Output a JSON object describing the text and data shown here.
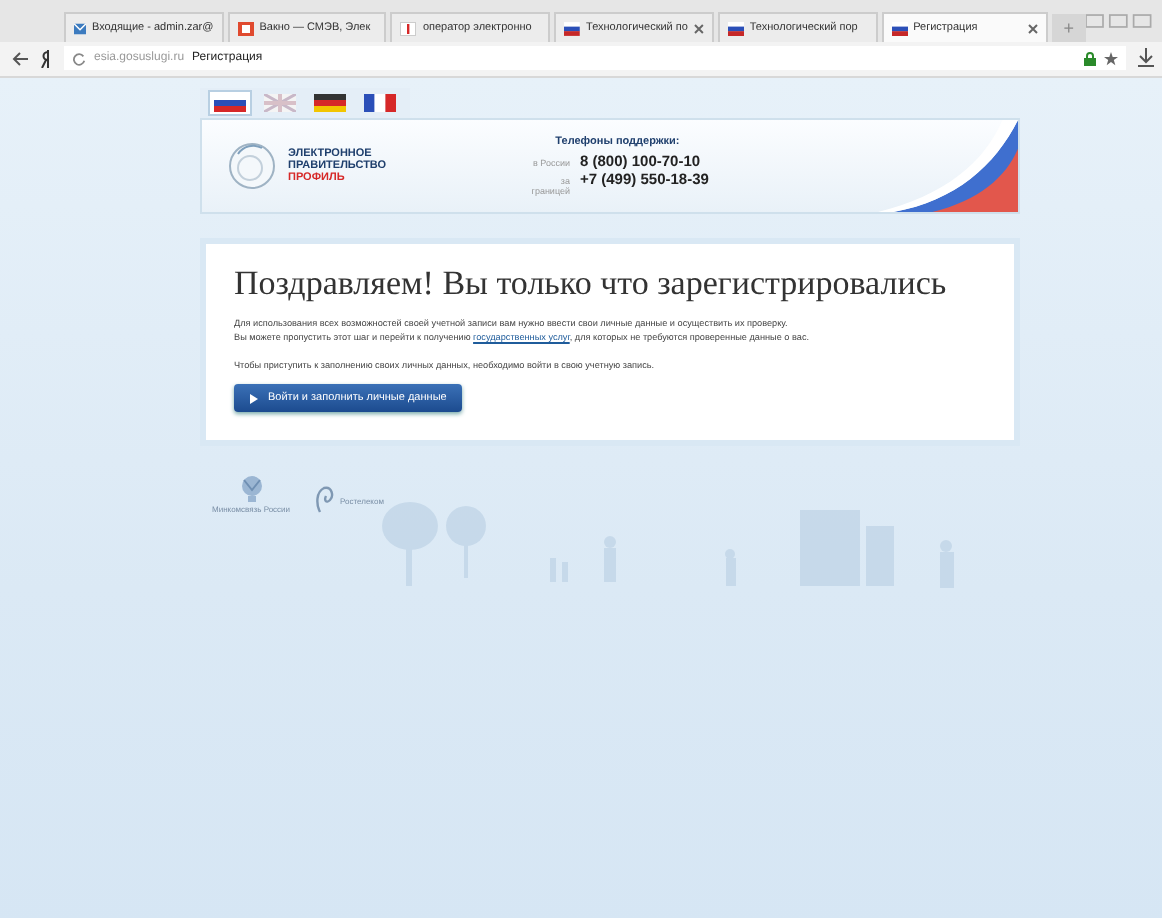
{
  "browser": {
    "tabs": [
      {
        "kind": "mail",
        "label": "Входящие - admin.zar@",
        "selected": false,
        "closable": false
      },
      {
        "kind": "square",
        "label": "Вакно — СМЭВ, Элек",
        "selected": false,
        "closable": false
      },
      {
        "kind": "info",
        "label": "оператор электронно",
        "selected": false,
        "closable": false
      },
      {
        "kind": "flag",
        "label": "Технологический по",
        "selected": false,
        "closable": true
      },
      {
        "kind": "flag",
        "label": "Технологический пор",
        "selected": false,
        "closable": false
      },
      {
        "kind": "flag",
        "label": "Регистрация",
        "selected": true,
        "closable": true
      }
    ],
    "new_tab": "+",
    "address": {
      "host": "esia.gosuslugi.ru",
      "title": "Регистрация"
    }
  },
  "languages": [
    {
      "kind": "ru",
      "selected": true
    },
    {
      "kind": "gb",
      "selected": false
    },
    {
      "kind": "de",
      "selected": false
    },
    {
      "kind": "fr",
      "selected": false
    }
  ],
  "header": {
    "logo_lines": [
      "ЭЛЕКТРОННОЕ",
      "ПРАВИТЕЛЬСТВО",
      "ПРОФИЛЬ"
    ],
    "support_title": "Телефоны поддержки:",
    "phones": [
      {
        "label": "в России",
        "number": "8 (800) 100-70-10"
      },
      {
        "label": "за границей",
        "number": "+7 (499) 550-18-39"
      }
    ]
  },
  "card": {
    "title": "Поздравляем! Вы только что зарегистрировались",
    "paragraphs": [
      [
        "Для использования всех возможностей своей учетной записи вам нужно ввести свои личные данные и осуществить их проверку.",
        "Вы можете пропустить этот шаг и перейти к получению ",
        {
          "link": "государственных услуг"
        },
        ", для которых не требуются проверенные данные о вас."
      ],
      [
        "Чтобы приступить к заполнению своих личных данных, необходимо войти в свою учетную запись."
      ]
    ],
    "button": "Войти и заполнить личные данные"
  },
  "footer": {
    "partners": [
      {
        "kind": "emblem",
        "label": "Минкомсвязь России"
      },
      {
        "kind": "rostelecom",
        "label": "Ростелеком"
      }
    ]
  }
}
